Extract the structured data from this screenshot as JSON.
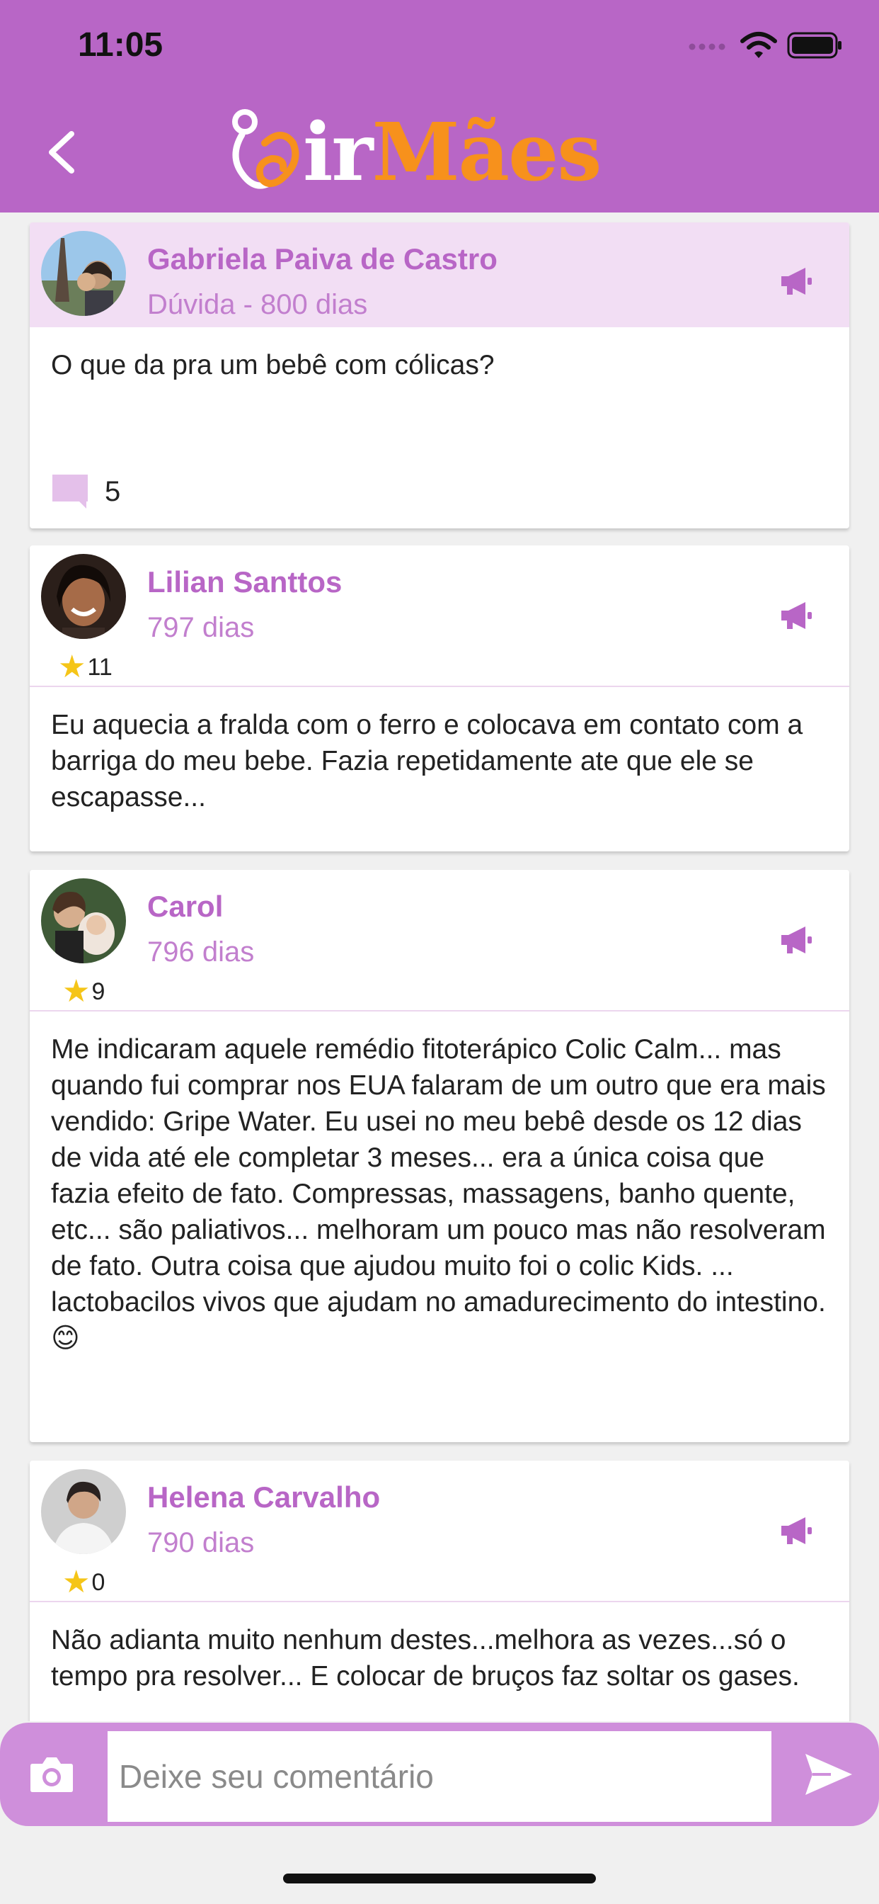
{
  "status_bar": {
    "time": "11:05"
  },
  "header": {
    "logo_part1": "ir",
    "logo_part2": "Mães"
  },
  "question": {
    "author": "Gabriela Paiva de Castro",
    "meta": "Dúvida - 800 dias",
    "text": "O que da pra um bebê com cólicas?",
    "comment_count": "5"
  },
  "answers": [
    {
      "author": "Lilian Santtos",
      "meta": "797 dias",
      "stars": "11",
      "text": "Eu aquecia a fralda com o ferro e colocava em contato com a barriga do meu bebe. Fazia repetidamente ate que ele se escapasse..."
    },
    {
      "author": "Carol",
      "meta": "796 dias",
      "stars": "9",
      "text": "Me indicaram aquele remédio fitoterápico Colic Calm... mas quando fui comprar nos EUA falaram de um outro que era mais vendido: Gripe  Water. Eu usei no meu bebê desde os 12 dias de vida até ele completar 3 meses... era a única coisa que fazia efeito de fato. Compressas, massagens, banho quente, etc... são paliativos... melhoram um pouco mas não resolveram de fato. Outra coisa que ajudou muito foi o colic Kids. ... lactobacilos vivos que ajudam no amadurecimento do intestino. 😊"
    },
    {
      "author": "Helena Carvalho",
      "meta": "790 dias",
      "stars": "0",
      "text": "Não adianta muito nenhum destes...melhora as vezes...só o tempo pra resolver... E colocar de bruços faz soltar os gases."
    }
  ],
  "compose": {
    "placeholder": "Deixe seu comentário"
  },
  "colors": {
    "brand_purple": "#b866c6",
    "brand_orange": "#f7911c",
    "question_bg": "#f2def4",
    "compose_bg": "#cf8fdb"
  }
}
